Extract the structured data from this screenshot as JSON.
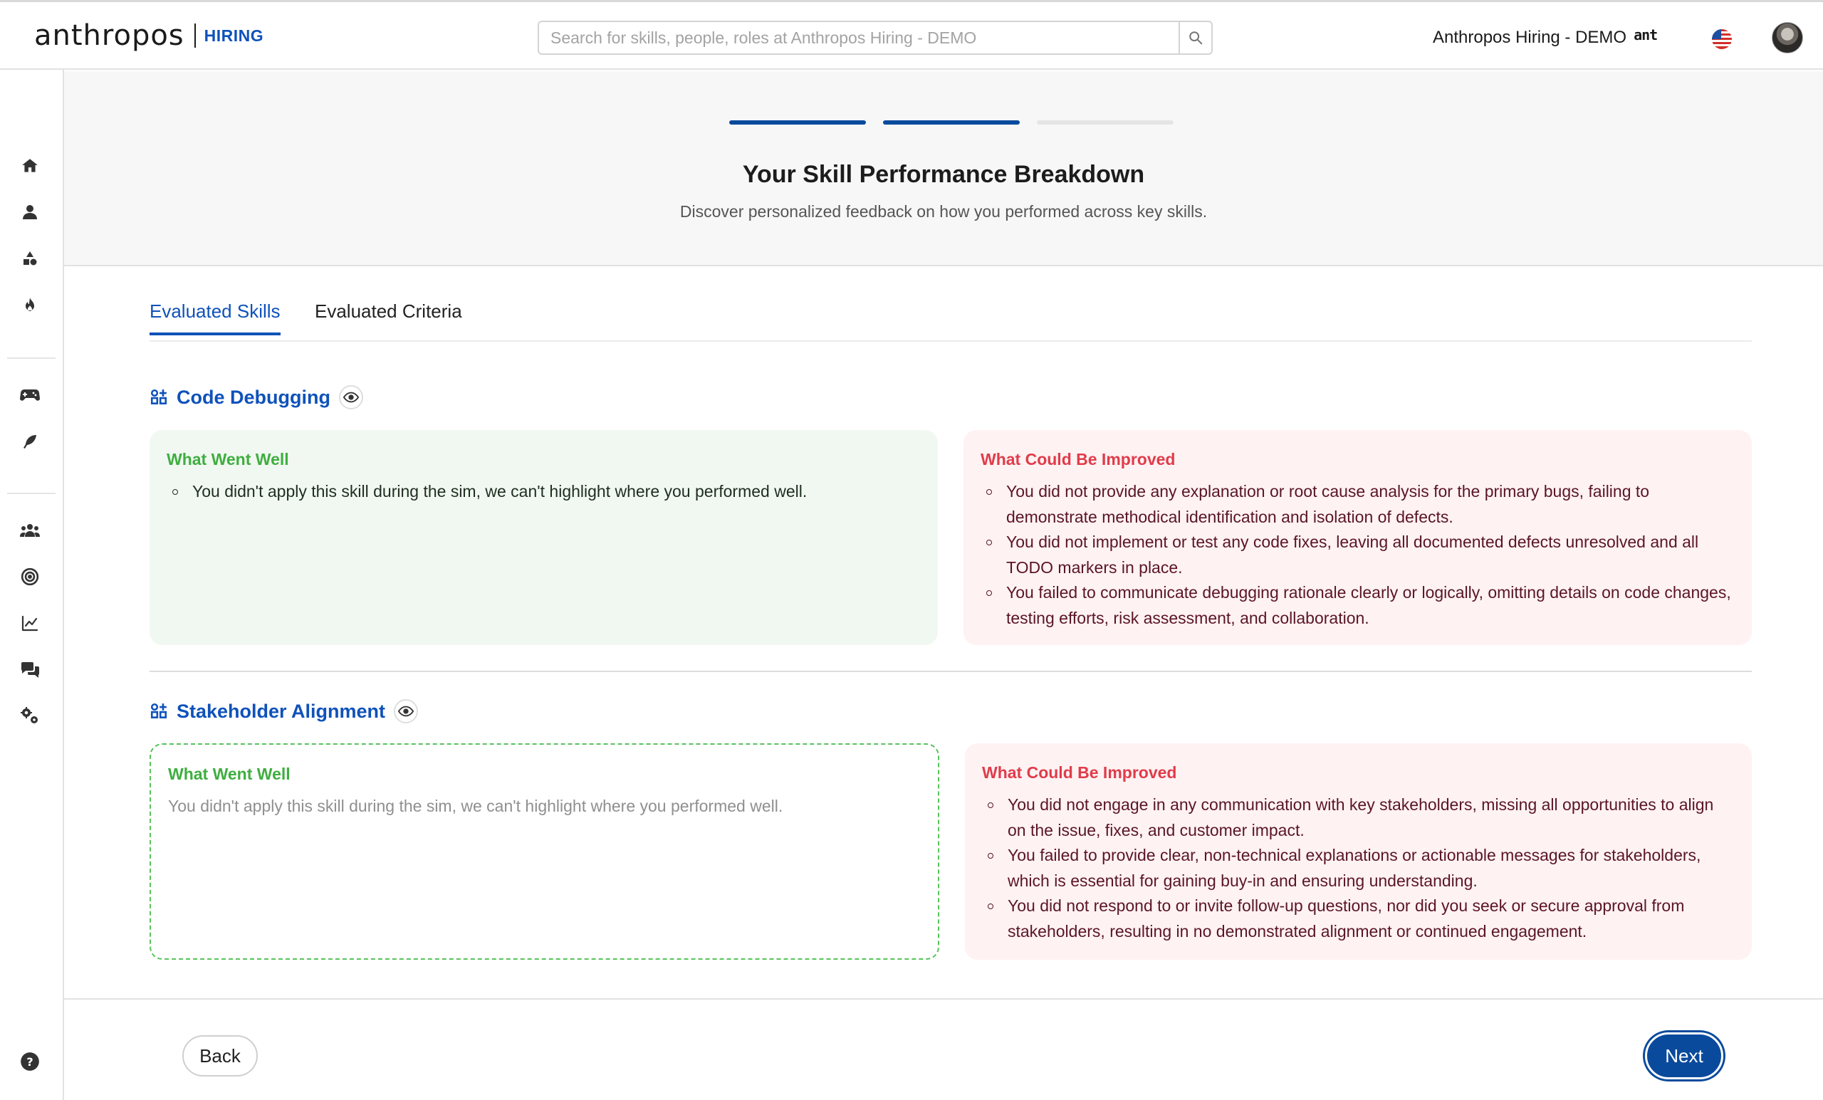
{
  "header": {
    "brand_name": "anthropos",
    "brand_tag": "HIRING",
    "search_placeholder": "Search for skills, people, roles at Anthropos Hiring - DEMO",
    "tenant_name": "Anthropos Hiring - DEMO",
    "tenant_logo": "ant"
  },
  "sidebar": {
    "icons": [
      "home-icon",
      "user-icon",
      "shapes-icon",
      "fire-icon",
      "gamepad-icon",
      "feather-icon",
      "team-icon",
      "target-icon",
      "chart-line-icon",
      "chat-icon",
      "gears-icon",
      "help-icon"
    ]
  },
  "hero": {
    "steps": [
      true,
      true,
      false
    ],
    "title": "Your Skill Performance Breakdown",
    "subtitle": "Discover personalized feedback on how you performed across key skills."
  },
  "tabs": [
    {
      "label": "Evaluated Skills",
      "active": true
    },
    {
      "label": "Evaluated Criteria",
      "active": false
    }
  ],
  "skills": [
    {
      "name": "Code Debugging",
      "well_title": "What Went Well",
      "well_items": [
        "You didn't apply this skill during the sim, we can't highlight where you performed well."
      ],
      "improve_title": "What Could Be Improved",
      "improve_items": [
        "You did not provide any explanation or root cause analysis for the primary bugs, failing to demonstrate methodical identification and isolation of defects.",
        "You did not implement or test any code fixes, leaving all documented defects unresolved and all TODO markers in place.",
        "You failed to communicate debugging rationale clearly or logically, omitting details on code changes, testing efforts, risk assessment, and collaboration."
      ]
    },
    {
      "name": "Stakeholder Alignment",
      "well_title": "What Went Well",
      "well_text": "You didn't apply this skill during the sim, we can't highlight where you performed well.",
      "improve_title": "What Could Be Improved",
      "improve_items": [
        "You did not engage in any communication with key stakeholders, missing all opportunities to align on the issue, fixes, and customer impact.",
        "You failed to provide clear, non-technical explanations or actionable messages for stakeholders, which is essential for gaining buy-in and ensuring understanding.",
        "You did not respond to or invite follow-up questions, nor did you seek or secure approval from stakeholders, resulting in no demonstrated alignment or continued engagement."
      ]
    }
  ],
  "footer": {
    "back_label": "Back",
    "next_label": "Next"
  },
  "colors": {
    "brand_blue": "#0f52ba",
    "primary_button": "#0a4a9c",
    "success_green": "#3fae3f",
    "danger_red": "#e03c4a"
  }
}
